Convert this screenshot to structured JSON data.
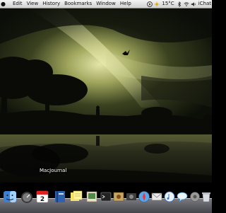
{
  "menubar": {
    "app_name": "",
    "items": [
      "Edit",
      "View",
      "History",
      "Bookmarks",
      "Window",
      "Help"
    ],
    "temperature": "15°C",
    "user": "iChat"
  },
  "desktop": {
    "file_label": "MacJournal"
  },
  "dock": {
    "calendar_day": "2"
  },
  "colors": {
    "sky_glow": "#c9cc86",
    "sky_dark": "#0b0f08",
    "water": "#22241a"
  }
}
